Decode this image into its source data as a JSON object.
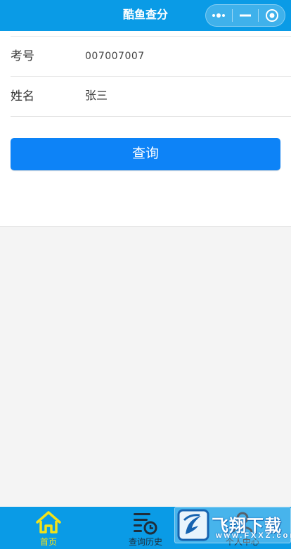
{
  "navbar": {
    "title": "酷鱼查分",
    "capsule": {
      "more_icon": "more-dots-icon",
      "minimize_icon": "minimize-icon",
      "close_icon": "target-close-icon"
    }
  },
  "form": {
    "fields": [
      {
        "label": "考号",
        "value": "007007007"
      },
      {
        "label": "姓名",
        "value": "张三"
      }
    ],
    "query_button": "查询"
  },
  "tabbar": {
    "tabs": [
      {
        "label": "首页",
        "icon": "home-icon",
        "active": true,
        "color": "#f2e21a"
      },
      {
        "label": "查询历史",
        "icon": "history-list-icon",
        "active": false,
        "color": "#ffffff"
      },
      {
        "label": "个人中心",
        "icon": "user-icon",
        "active": false,
        "color": "#ffffff"
      }
    ]
  },
  "watermark": {
    "title": "飞翔下载",
    "subtitle": "www.FXXZ.com",
    "icon": "fxxz-logo-icon"
  },
  "colors": {
    "navbar": "#0a9be6",
    "button": "#0d83f7",
    "active_tab": "#f2e21a",
    "background": "#f4f4f4"
  }
}
